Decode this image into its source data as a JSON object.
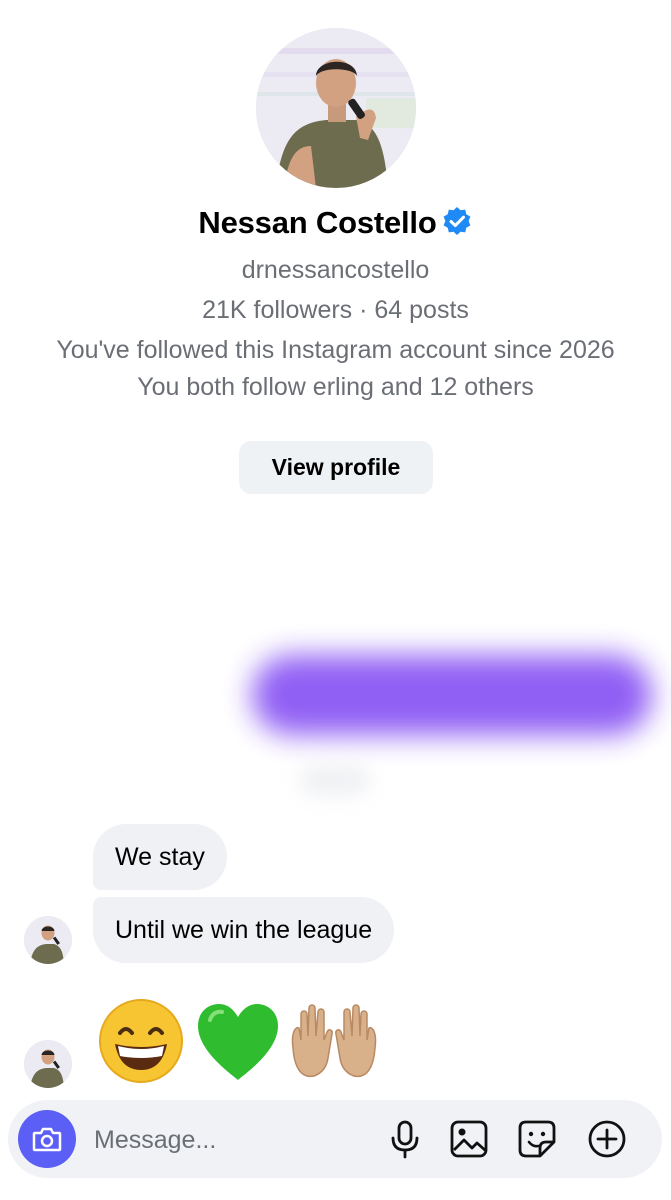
{
  "profile": {
    "name": "Nessan Costello",
    "username": "drnessancostello",
    "stats": "21K followers · 64 posts",
    "followed_since": "You've followed this Instagram account since 2026",
    "mutuals": "You both follow erling and 12 others",
    "view_profile_label": "View profile",
    "verified": true
  },
  "messages": [
    {
      "text": "We stay"
    },
    {
      "text": "Until we win the league"
    }
  ],
  "emoji_message": [
    "grinning-face-with-smiling-eyes",
    "green-heart",
    "palms-up-together-medium-light-skin-tone"
  ],
  "composer": {
    "placeholder": "Message..."
  },
  "colors": {
    "accent": "#5b5ff5",
    "verified_badge": "#1f8af5",
    "bubble": "#eff1f4",
    "blurred_sent_message": "#8b57f4"
  }
}
